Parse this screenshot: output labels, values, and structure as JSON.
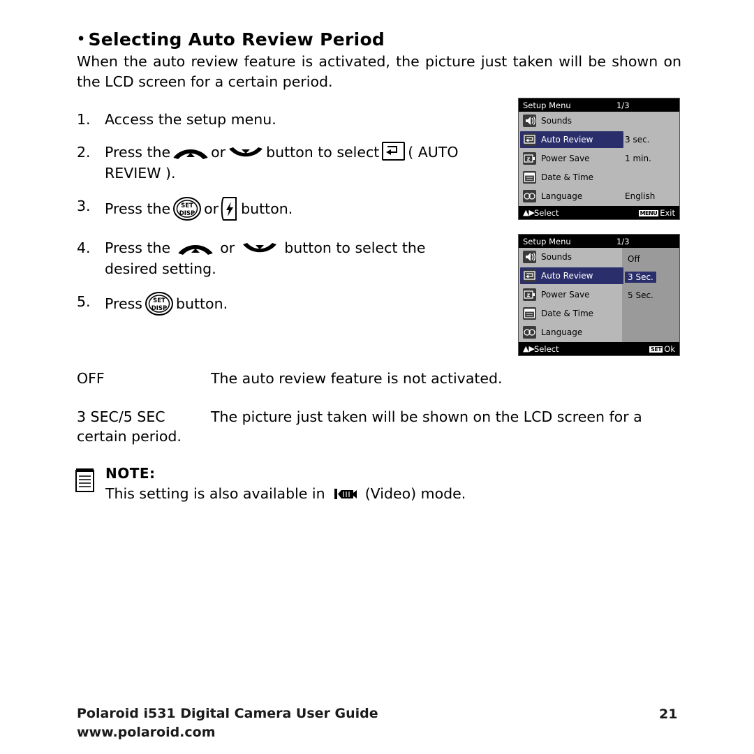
{
  "heading": {
    "bullet": "•",
    "text": "Selecting Auto Review Period"
  },
  "intro": "When the auto review feature is activated, the picture just taken will be shown on the LCD screen for a certain period.",
  "steps": [
    {
      "num": "1.",
      "parts": [
        "Access the setup menu."
      ]
    },
    {
      "num": "2.",
      "parts": [
        "Press the ",
        "[up-icon]",
        " or ",
        "[down-icon]",
        " button to select ",
        "[auto-review-icon]",
        " ( AUTO REVIEW )."
      ]
    },
    {
      "num": "3.",
      "parts": [
        "Press the ",
        "[set-disp-icon]",
        " or ",
        "[flash-icon]",
        " button."
      ]
    },
    {
      "num": "4.",
      "parts": [
        "Press the ",
        "[up-icon]",
        " or ",
        "[down-icon]",
        " button to select the desired setting."
      ]
    },
    {
      "num": "5.",
      "parts": [
        "Press ",
        "[set-disp-icon]",
        " button."
      ]
    }
  ],
  "step_text": {
    "s1": "Access the setup menu.",
    "s2_a": "Press the",
    "s2_b": "or",
    "s2_c": "button to select",
    "s2_d": "( AUTO",
    "s2_e": "REVIEW ).",
    "s3_a": "Press the",
    "s3_b": "or",
    "s3_c": "button.",
    "s4_a": "Press  the",
    "s4_b": "or",
    "s4_c": "button  to  select  the",
    "s4_d": "desired setting.",
    "s5_a": "Press",
    "s5_b": "button."
  },
  "definitions": [
    {
      "term": "OFF",
      "description": "The auto review feature is not activated."
    },
    {
      "term": "3 SEC/5 SEC",
      "description": "The picture just taken will be shown on the LCD screen for a certain period."
    }
  ],
  "note": {
    "title": "NOTE:",
    "body_before": "This setting is also available in",
    "body_after": "(Video) mode."
  },
  "lcd_screens": [
    {
      "id": "screen1",
      "title": "Setup Menu",
      "page": "1/3",
      "rows": [
        {
          "icon": "sounds-icon",
          "label": "Sounds",
          "value": "",
          "selected": false
        },
        {
          "icon": "auto-review-icon",
          "label": "Auto Review",
          "value": "3 sec.",
          "selected": true
        },
        {
          "icon": "power-save-icon",
          "label": "Power Save",
          "value": "1 min.",
          "selected": false
        },
        {
          "icon": "date-time-icon",
          "label": "Date & Time",
          "value": "",
          "selected": false
        },
        {
          "icon": "language-icon",
          "label": "Language",
          "value": "English",
          "selected": false
        }
      ],
      "footer_left": "Select",
      "footer_right": "Exit",
      "footer_right_key": "MENU"
    },
    {
      "id": "screen2",
      "title": "Setup Menu",
      "page": "1/3",
      "rows": [
        {
          "icon": "sounds-icon",
          "label": "Sounds",
          "value": "",
          "selected": false
        },
        {
          "icon": "auto-review-icon",
          "label": "Auto Review",
          "value": "",
          "selected": true
        },
        {
          "icon": "power-save-icon",
          "label": "Power Save",
          "value": "",
          "selected": false
        },
        {
          "icon": "date-time-icon",
          "label": "Date & Time",
          "value": "",
          "selected": false
        },
        {
          "icon": "language-icon",
          "label": "Language",
          "value": "",
          "selected": false
        }
      ],
      "submenu": [
        {
          "label": "Off",
          "highlight": false
        },
        {
          "label": "3 Sec.",
          "highlight": true
        },
        {
          "label": "5 Sec.",
          "highlight": false
        }
      ],
      "footer_left": "Select",
      "footer_right": "Ok",
      "footer_right_key": "SET"
    }
  ],
  "footer": {
    "line1": "Polaroid i531 Digital Camera User Guide",
    "line2": "www.polaroid.com",
    "page_number": "21"
  },
  "colors": {
    "lcd_background": "#b8b8b8",
    "lcd_bar": "#000000",
    "selection": "#2a2f6b",
    "subpane": "#9a9a9a",
    "icon_tile": "#3a3a3a",
    "text": "#000000"
  }
}
